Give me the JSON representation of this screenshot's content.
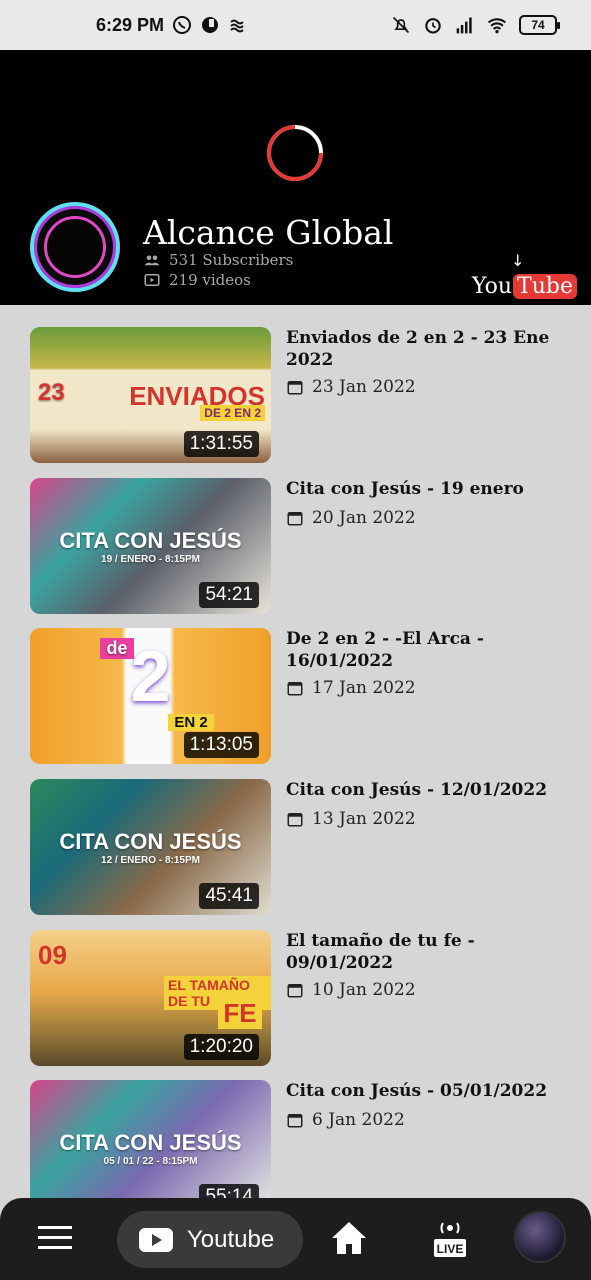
{
  "status_bar": {
    "time": "6:29 PM",
    "battery": "74",
    "icons": [
      "whatsapp-icon",
      "app-icon",
      "wave-icon",
      "mute-icon",
      "alarm-icon",
      "signal-icon",
      "wifi-icon",
      "battery-icon"
    ]
  },
  "channel": {
    "title": "Alcance Global",
    "subscribers": "531 Subscribers",
    "videos": "219 videos",
    "yt_logo_you": "You",
    "yt_logo_tube": "Tube",
    "accent": "#e53935"
  },
  "videos": [
    {
      "title": "Enviados de 2 en 2 - 23 Ene 2022",
      "date": "23 Jan 2022",
      "duration": "1:31:55",
      "thumb_line1": "23",
      "thumb_line2": "ENVIADOS",
      "thumb_line3": "DE 2 EN 2"
    },
    {
      "title": "Cita con Jesús - 19 enero",
      "date": "20 Jan 2022",
      "duration": "54:21",
      "thumb_line1": "CITA CON JESÚS",
      "thumb_line2": "19 / ENERO - 8:15PM",
      "thumb_line3": ""
    },
    {
      "title": "De 2 en 2 - -El Arca - 16/01/2022",
      "date": "17 Jan 2022",
      "duration": "1:13:05",
      "thumb_line1": "de",
      "thumb_line2": "2",
      "thumb_line3": "EN 2"
    },
    {
      "title": "Cita con Jesús - 12/01/2022",
      "date": "13 Jan 2022",
      "duration": "45:41",
      "thumb_line1": "CITA CON JESÚS",
      "thumb_line2": "12 / ENERO - 8:15PM",
      "thumb_line3": ""
    },
    {
      "title": "El tamaño de tu fe - 09/01/2022",
      "date": "10 Jan 2022",
      "duration": "1:20:20",
      "thumb_line1": "09",
      "thumb_line2": "EL TAMAÑO DE TU",
      "thumb_line3": "FE"
    },
    {
      "title": "Cita con Jesús - 05/01/2022",
      "date": "6 Jan 2022",
      "duration": "55:14",
      "thumb_line1": "CITA CON JESÚS",
      "thumb_line2": "05 / 01 / 22 - 8:15PM",
      "thumb_line3": ""
    }
  ],
  "nav": {
    "youtube_label": "Youtube",
    "items": [
      "menu-icon",
      "youtube-tab",
      "home-icon",
      "live-icon",
      "profile-avatar"
    ]
  }
}
